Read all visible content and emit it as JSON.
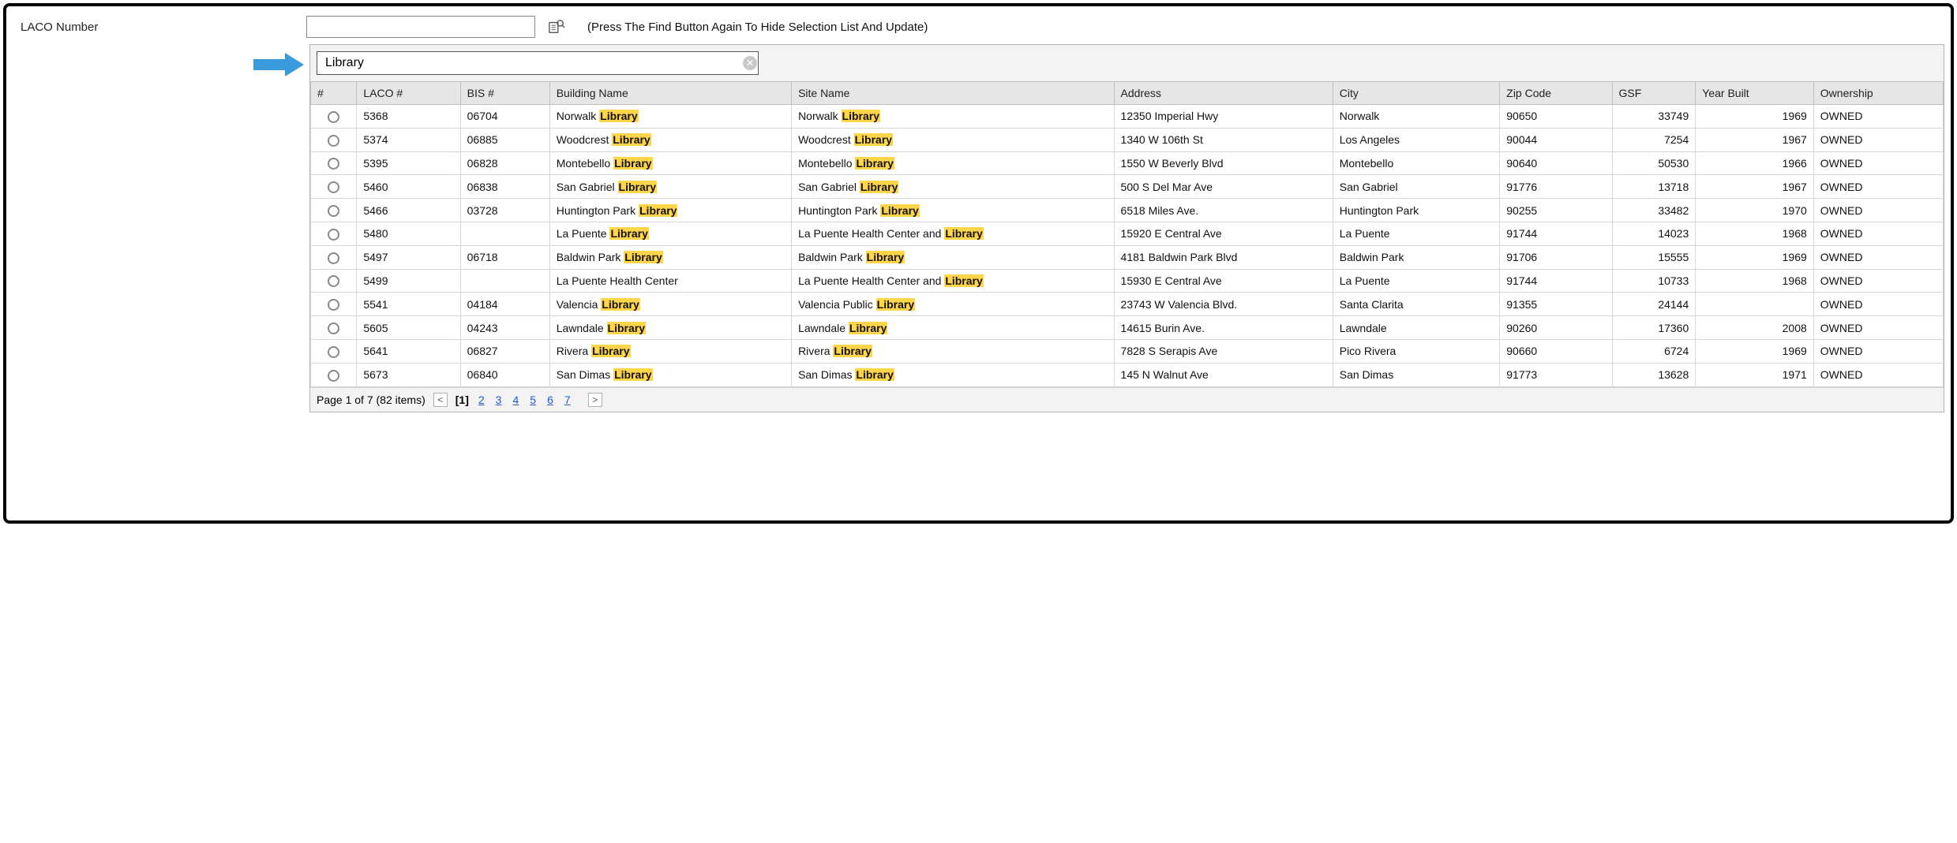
{
  "header": {
    "label": "LACO Number",
    "hint": "(Press The Find Button Again To Hide Selection List And Update)",
    "laco_value": ""
  },
  "search": {
    "value": "Library",
    "highlight": "Library"
  },
  "columns": [
    "#",
    "LACO #",
    "BIS #",
    "Building Name",
    "Site Name",
    "Address",
    "City",
    "Zip Code",
    "GSF",
    "Year Built",
    "Ownership"
  ],
  "rows": [
    {
      "laco": "5368",
      "bis": "06704",
      "bname": "Norwalk Library",
      "sname": "Norwalk Library",
      "addr": "12350 Imperial Hwy",
      "city": "Norwalk",
      "zip": "90650",
      "gsf": "33749",
      "year": "1969",
      "own": "OWNED"
    },
    {
      "laco": "5374",
      "bis": "06885",
      "bname": "Woodcrest Library",
      "sname": "Woodcrest Library",
      "addr": "1340 W 106th St",
      "city": "Los Angeles",
      "zip": "90044",
      "gsf": "7254",
      "year": "1967",
      "own": "OWNED"
    },
    {
      "laco": "5395",
      "bis": "06828",
      "bname": "Montebello Library",
      "sname": "Montebello Library",
      "addr": "1550 W Beverly Blvd",
      "city": "Montebello",
      "zip": "90640",
      "gsf": "50530",
      "year": "1966",
      "own": "OWNED"
    },
    {
      "laco": "5460",
      "bis": "06838",
      "bname": "San Gabriel Library",
      "sname": "San Gabriel Library",
      "addr": "500 S Del Mar Ave",
      "city": "San Gabriel",
      "zip": "91776",
      "gsf": "13718",
      "year": "1967",
      "own": "OWNED"
    },
    {
      "laco": "5466",
      "bis": "03728",
      "bname": "Huntington Park Library",
      "sname": "Huntington Park Library",
      "addr": "6518 Miles Ave.",
      "city": "Huntington Park",
      "zip": "90255",
      "gsf": "33482",
      "year": "1970",
      "own": "OWNED"
    },
    {
      "laco": "5480",
      "bis": "",
      "bname": "La Puente Library",
      "sname": "La Puente Health Center and Library",
      "addr": "15920 E Central Ave",
      "city": "La Puente",
      "zip": "91744",
      "gsf": "14023",
      "year": "1968",
      "own": "OWNED"
    },
    {
      "laco": "5497",
      "bis": "06718",
      "bname": "Baldwin Park Library",
      "sname": "Baldwin Park Library",
      "addr": "4181 Baldwin Park Blvd",
      "city": "Baldwin Park",
      "zip": "91706",
      "gsf": "15555",
      "year": "1969",
      "own": "OWNED"
    },
    {
      "laco": "5499",
      "bis": "",
      "bname": "La Puente Health Center",
      "sname": "La Puente Health Center and Library",
      "addr": "15930 E Central Ave",
      "city": "La Puente",
      "zip": "91744",
      "gsf": "10733",
      "year": "1968",
      "own": "OWNED"
    },
    {
      "laco": "5541",
      "bis": "04184",
      "bname": "Valencia Library",
      "sname": "Valencia Public Library",
      "addr": "23743 W Valencia Blvd.",
      "city": "Santa Clarita",
      "zip": "91355",
      "gsf": "24144",
      "year": "",
      "own": "OWNED"
    },
    {
      "laco": "5605",
      "bis": "04243",
      "bname": "Lawndale Library",
      "sname": "Lawndale Library",
      "addr": "14615 Burin Ave.",
      "city": "Lawndale",
      "zip": "90260",
      "gsf": "17360",
      "year": "2008",
      "own": "OWNED"
    },
    {
      "laco": "5641",
      "bis": "06827",
      "bname": "Rivera Library",
      "sname": "Rivera Library",
      "addr": "7828 S Serapis Ave",
      "city": "Pico Rivera",
      "zip": "90660",
      "gsf": "6724",
      "year": "1969",
      "own": "OWNED"
    },
    {
      "laco": "5673",
      "bis": "06840",
      "bname": "San Dimas Library",
      "sname": "San Dimas Library",
      "addr": "145 N Walnut Ave",
      "city": "San Dimas",
      "zip": "91773",
      "gsf": "13628",
      "year": "1971",
      "own": "OWNED"
    }
  ],
  "pager": {
    "summary": "Page 1 of 7 (82 items)",
    "current": 1,
    "pages": [
      1,
      2,
      3,
      4,
      5,
      6,
      7
    ]
  }
}
